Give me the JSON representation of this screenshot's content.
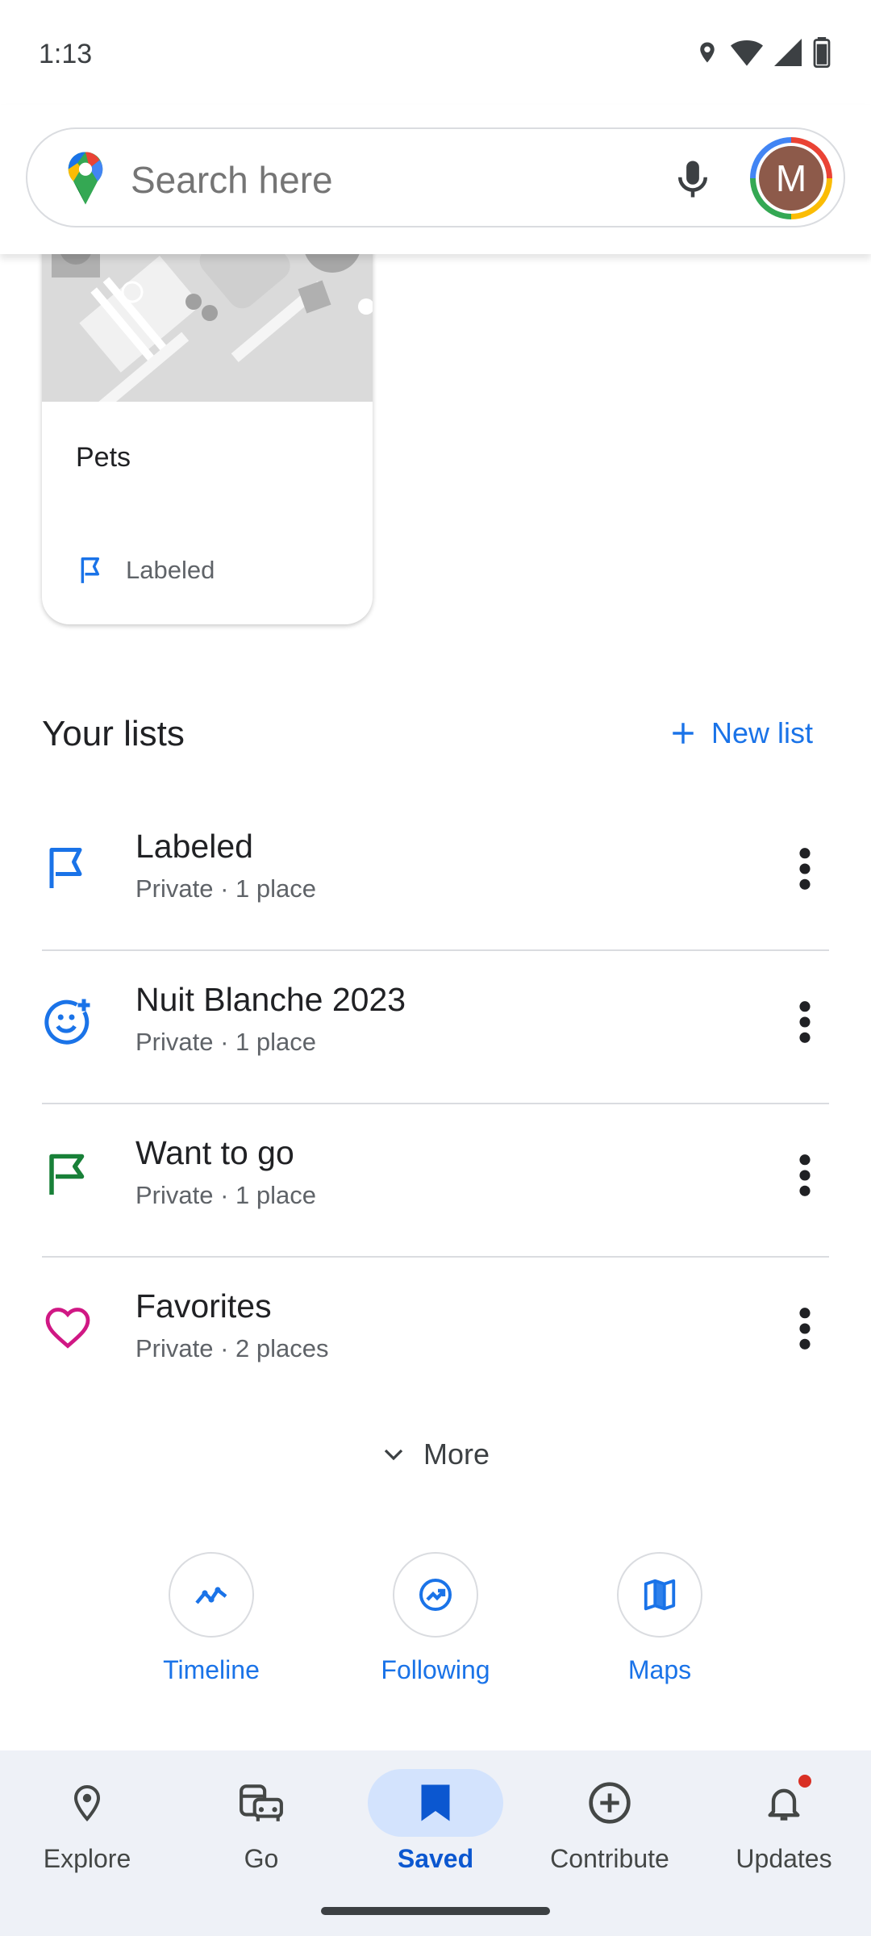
{
  "status": {
    "time": "1:13"
  },
  "search": {
    "placeholder": "Search here",
    "avatar_letter": "M"
  },
  "card": {
    "title": "Pets",
    "list_label": "Labeled"
  },
  "lists": {
    "header": "Your lists",
    "new_list": "New list",
    "items": [
      {
        "title": "Labeled",
        "subtitle": "Private · 1 place",
        "icon": "flag-outline-icon",
        "color": "#1a73e8"
      },
      {
        "title": "Nuit Blanche 2023",
        "subtitle": "Private · 1 place",
        "icon": "emoji-add-icon",
        "color": "#1a73e8"
      },
      {
        "title": "Want to go",
        "subtitle": "Private · 1 place",
        "icon": "flag-icon",
        "color": "#188038"
      },
      {
        "title": "Favorites",
        "subtitle": "Private · 2 places",
        "icon": "heart-icon",
        "color": "#d01884"
      }
    ],
    "more": "More"
  },
  "shortcuts": [
    {
      "label": "Timeline",
      "icon": "timeline-icon"
    },
    {
      "label": "Following",
      "icon": "following-icon"
    },
    {
      "label": "Maps",
      "icon": "map-icon"
    }
  ],
  "nav": {
    "items": [
      {
        "label": "Explore",
        "icon": "location-pin-icon"
      },
      {
        "label": "Go",
        "icon": "commute-icon"
      },
      {
        "label": "Saved",
        "icon": "bookmark-icon",
        "active": true
      },
      {
        "label": "Contribute",
        "icon": "add-circle-icon"
      },
      {
        "label": "Updates",
        "icon": "bell-icon",
        "badge": true
      }
    ]
  },
  "colors": {
    "accent": "#1a73e8",
    "nav_active": "#0b57d0",
    "nav_bg": "#eef1f7"
  }
}
